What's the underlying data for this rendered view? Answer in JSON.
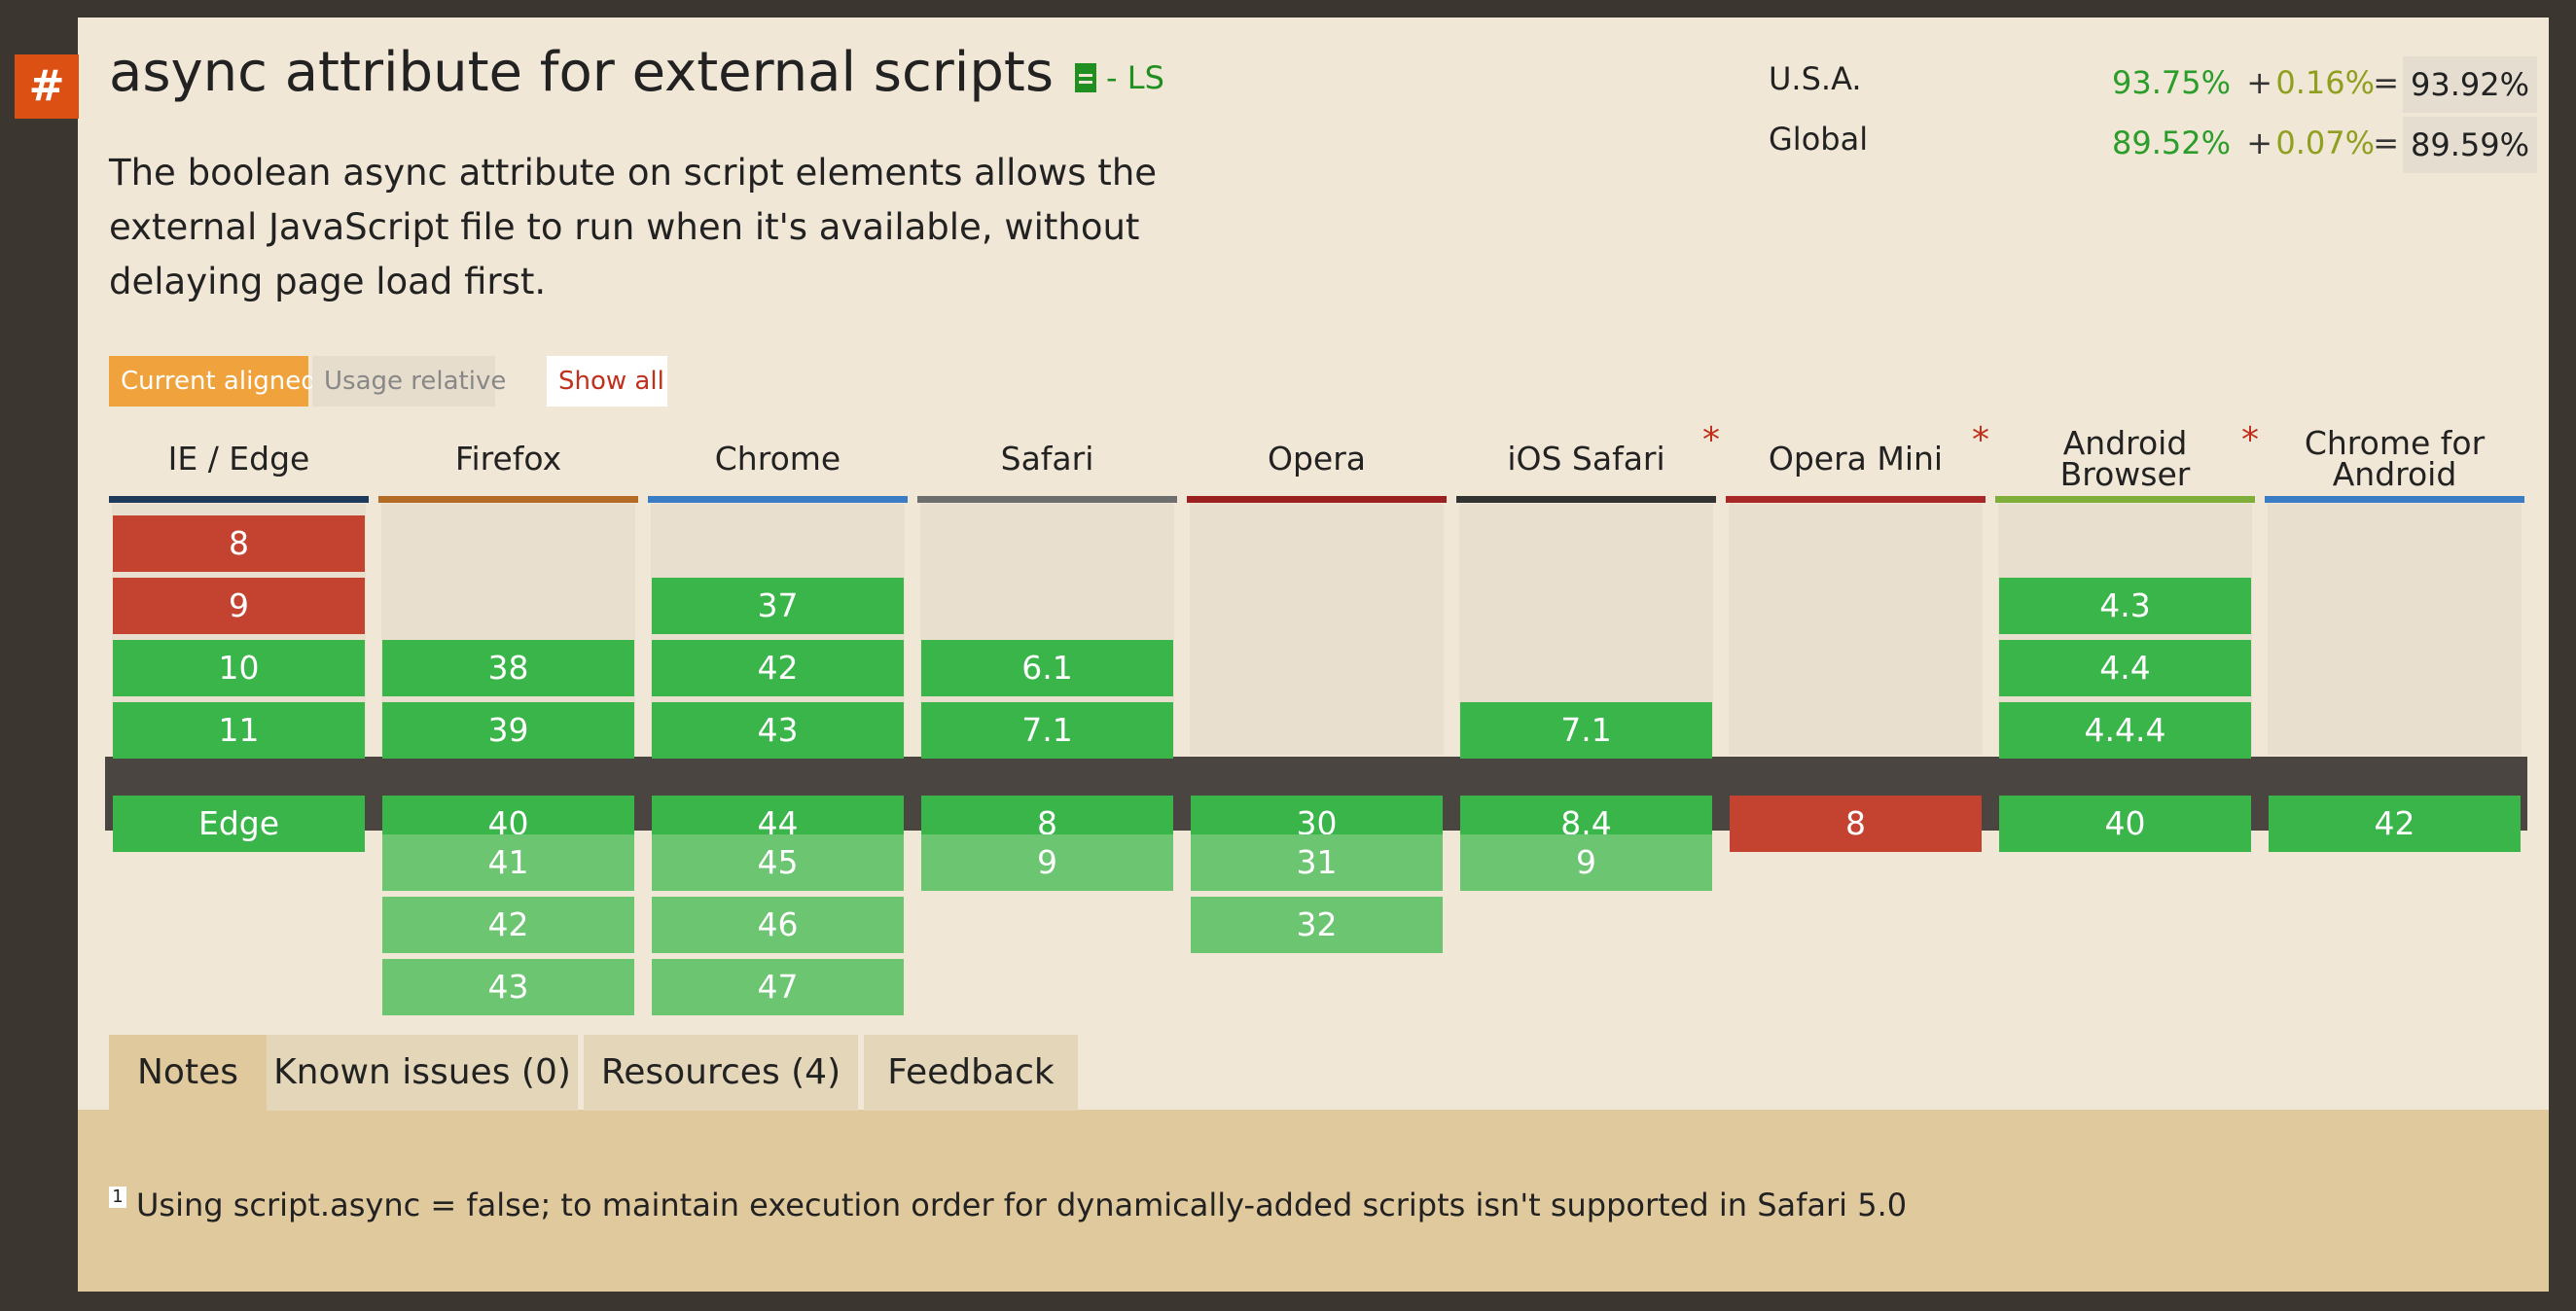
{
  "feature": {
    "hash": "#",
    "title": "async attribute for external scripts",
    "status": "- LS",
    "description": "The boolean async attribute on script elements allows the external JavaScript file to run when it's available, without delaying page load first."
  },
  "usage": [
    {
      "region": "U.S.A.",
      "supported": "93.75%",
      "partial": "0.16%",
      "total": "93.92%"
    },
    {
      "region": "Global",
      "supported": "89.52%",
      "partial": "0.07%",
      "total": "89.59%"
    }
  ],
  "operators": {
    "plus": "+",
    "equals": "="
  },
  "controls": {
    "current_aligned": "Current aligned",
    "usage_relative": "Usage relative",
    "show_all": "Show all"
  },
  "colors": {
    "supported": "#39b54a",
    "not_supported": "#c44230",
    "future": "#6cc571",
    "accent": "#f0a23c",
    "star": "#c0301c"
  },
  "browsers": [
    {
      "name": "IE / Edge",
      "bar": "#1e3a5c",
      "star": false,
      "past": [
        {
          "v": "8",
          "s": "n"
        },
        {
          "v": "9",
          "s": "n"
        },
        {
          "v": "10",
          "s": "y"
        },
        {
          "v": "11",
          "s": "y"
        }
      ],
      "current": {
        "v": "Edge",
        "s": "y"
      },
      "future": []
    },
    {
      "name": "Firefox",
      "bar": "#b36b26",
      "star": false,
      "past": [
        {
          "v": "",
          "s": "e"
        },
        {
          "v": "",
          "s": "e"
        },
        {
          "v": "38",
          "s": "y"
        },
        {
          "v": "39",
          "s": "y"
        }
      ],
      "current": {
        "v": "40",
        "s": "y"
      },
      "future": [
        "41",
        "42",
        "43"
      ]
    },
    {
      "name": "Chrome",
      "bar": "#3b7dc4",
      "star": false,
      "past": [
        {
          "v": "",
          "s": "e"
        },
        {
          "v": "37",
          "s": "y"
        },
        {
          "v": "42",
          "s": "y"
        },
        {
          "v": "43",
          "s": "y"
        }
      ],
      "current": {
        "v": "44",
        "s": "y"
      },
      "future": [
        "45",
        "46",
        "47"
      ]
    },
    {
      "name": "Safari",
      "bar": "#6e6e6e",
      "star": false,
      "past": [
        {
          "v": "",
          "s": "e"
        },
        {
          "v": "",
          "s": "e"
        },
        {
          "v": "6.1",
          "s": "y"
        },
        {
          "v": "7.1",
          "s": "y"
        }
      ],
      "current": {
        "v": "8",
        "s": "y"
      },
      "future": [
        "9"
      ]
    },
    {
      "name": "Opera",
      "bar": "#9b2020",
      "star": false,
      "past": [
        {
          "v": "",
          "s": "e"
        },
        {
          "v": "",
          "s": "e"
        },
        {
          "v": "",
          "s": "e"
        },
        {
          "v": "",
          "s": "e"
        }
      ],
      "current": {
        "v": "30",
        "s": "y"
      },
      "future": [
        "31",
        "32"
      ]
    },
    {
      "name": "iOS Safari",
      "bar": "#333333",
      "star": true,
      "past": [
        {
          "v": "",
          "s": "e"
        },
        {
          "v": "",
          "s": "e"
        },
        {
          "v": "",
          "s": "e"
        },
        {
          "v": "7.1",
          "s": "y"
        }
      ],
      "current": {
        "v": "8.4",
        "s": "y"
      },
      "future": [
        "9"
      ]
    },
    {
      "name": "Opera Mini",
      "bar": "#a82828",
      "star": true,
      "past": [
        {
          "v": "",
          "s": "e"
        },
        {
          "v": "",
          "s": "e"
        },
        {
          "v": "",
          "s": "e"
        },
        {
          "v": "",
          "s": "e"
        }
      ],
      "current": {
        "v": "8",
        "s": "n"
      },
      "future": []
    },
    {
      "name": "Android Browser",
      "bar": "#7fae3a",
      "star": true,
      "past": [
        {
          "v": "",
          "s": "e"
        },
        {
          "v": "4.3",
          "s": "y"
        },
        {
          "v": "4.4",
          "s": "y"
        },
        {
          "v": "4.4.4",
          "s": "y"
        }
      ],
      "current": {
        "v": "40",
        "s": "y"
      },
      "future": []
    },
    {
      "name": "Chrome for\nAndroid",
      "bar": "#3b7dc4",
      "star": false,
      "past": [
        {
          "v": "",
          "s": "e"
        },
        {
          "v": "",
          "s": "e"
        },
        {
          "v": "",
          "s": "e"
        },
        {
          "v": "",
          "s": "e"
        }
      ],
      "current": {
        "v": "42",
        "s": "y"
      },
      "future": []
    }
  ],
  "tabs": [
    "Notes",
    "Known issues (0)",
    "Resources (4)",
    "Feedback"
  ],
  "note": {
    "number": "1",
    "text": "Using script.async = false; to maintain execution order for dynamically-added scripts isn't supported in Safari 5.0"
  }
}
